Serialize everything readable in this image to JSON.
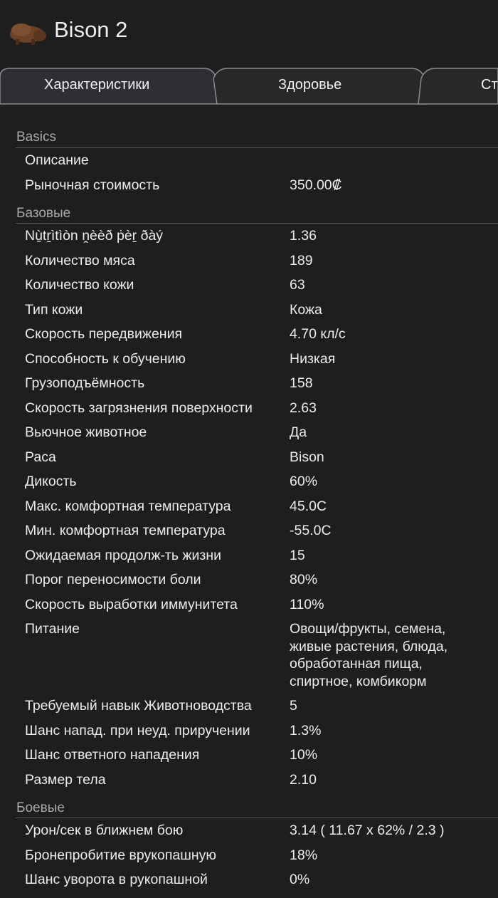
{
  "header": {
    "title": "Bison 2",
    "icon": "bison-icon"
  },
  "tabs": [
    {
      "label": "Характеристики"
    },
    {
      "label": "Здоровье"
    },
    {
      "label": "Ст"
    }
  ],
  "sections": {
    "basics": {
      "title": "Basics",
      "rows": [
        {
          "label": "Описание",
          "value": ""
        },
        {
          "label": "Рыночная стоимость",
          "value": "350.00₡"
        }
      ]
    },
    "base": {
      "title": "Базовые",
      "rows": [
        {
          "label": "Nù̱tṟìtìòn ṋèèð ṗèṟ ðàý",
          "value": "1.36"
        },
        {
          "label": "Количество мяса",
          "value": "189"
        },
        {
          "label": "Количество кожи",
          "value": "63"
        },
        {
          "label": "Тип кожи",
          "value": "Кожа"
        },
        {
          "label": "Скорость передвижения",
          "value": "4.70 кл/с"
        },
        {
          "label": "Способность к обучению",
          "value": "Низкая"
        },
        {
          "label": "Грузоподъёмность",
          "value": "158"
        },
        {
          "label": "Скорость загрязнения поверхности",
          "value": "2.63"
        },
        {
          "label": "Вьючное животное",
          "value": "Да"
        },
        {
          "label": "Раса",
          "value": "Bison"
        },
        {
          "label": "Дикость",
          "value": "60%"
        },
        {
          "label": "Макс. комфортная температура",
          "value": "45.0C"
        },
        {
          "label": "Мин. комфортная температура",
          "value": "-55.0C"
        },
        {
          "label": "Ожидаемая продолж-ть жизни",
          "value": "15"
        },
        {
          "label": "Порог переносимости боли",
          "value": "80%"
        },
        {
          "label": "Скорость выработки иммунитета",
          "value": "110%"
        },
        {
          "label": "Питание",
          "value": "Овощи/фрукты, семена, живые растения, блюда, обработанная пища, спиртное, комбикорм"
        },
        {
          "label": "Требуемый навык Животноводства",
          "value": "5"
        },
        {
          "label": "Шанс напад. при неуд. приручении",
          "value": "1.3%"
        },
        {
          "label": "Шанс ответного нападения",
          "value": "10%"
        },
        {
          "label": "Размер тела",
          "value": "2.10"
        }
      ]
    },
    "combat": {
      "title": "Боевые",
      "rows": [
        {
          "label": "Урон/сек в ближнем бою",
          "value": "3.14 ( 11.67 x 62% / 2.3 )"
        },
        {
          "label": "Бронепробитие врукопашную",
          "value": "18%"
        },
        {
          "label": "Шанс уворота в рукопашной",
          "value": "0%"
        }
      ]
    }
  }
}
